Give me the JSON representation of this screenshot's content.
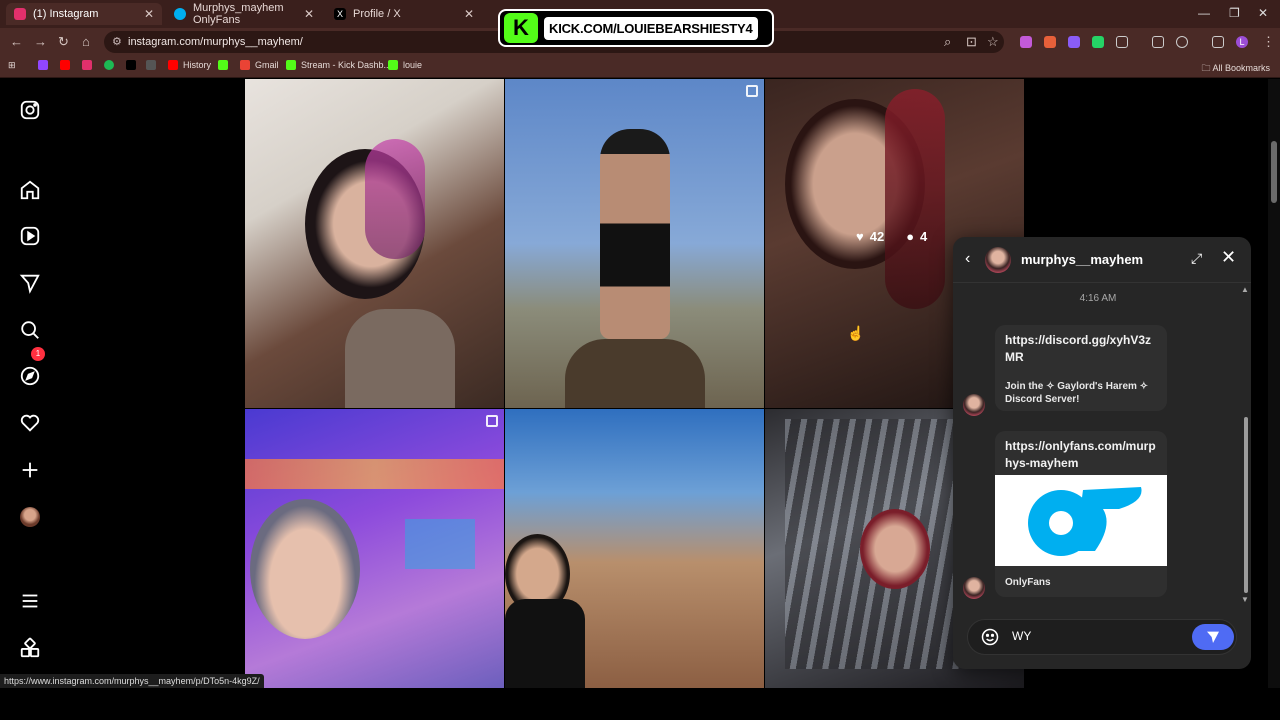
{
  "browser": {
    "tabs": [
      {
        "label": "(1) Instagram",
        "color": "#e1306c"
      },
      {
        "label": "Murphys_mayhem OnlyFans",
        "color": "#00aff0"
      },
      {
        "label": "Profile / X",
        "color": "#000000"
      }
    ],
    "url": "instagram.com/murphys__mayhem/",
    "bookmarks": [
      "History",
      "Gmail",
      "Stream - Kick Dashb...",
      "louie"
    ],
    "all_bookmarks": "All Bookmarks",
    "status_url": "https://www.instagram.com/murphys__mayhem/p/DTo5n-4kg9Z/"
  },
  "overlay": {
    "kick_logo": "K",
    "kick_text": "KICK.COM/LOUIEBEARSHIESTY4"
  },
  "sidebar": {
    "icons": [
      "instagram-icon",
      "home-icon",
      "reels-icon",
      "messages-icon",
      "search-icon",
      "explore-icon",
      "notifications-icon",
      "create-icon",
      "profile-icon",
      "more-icon",
      "also-from-meta-icon"
    ],
    "messages_badge": "1"
  },
  "grid": {
    "hover": {
      "likes": "42",
      "comments": "4"
    }
  },
  "chat": {
    "username": "murphys__mayhem",
    "time": "4:16 AM",
    "messages": [
      {
        "link": "https://discord.gg/xyhV3zMR",
        "desc": "Join the ✧ Gaylord's Harem ✧ Discord Server!"
      },
      {
        "link": "https://onlyfans.com/murphys-mayhem",
        "desc": "OnlyFans"
      }
    ],
    "composer_value": "WY"
  },
  "colors": {
    "accent": "#4f6bf4",
    "badge": "#ff3040",
    "kick_green": "#53fc18",
    "onlyfans_blue": "#00aff0"
  }
}
